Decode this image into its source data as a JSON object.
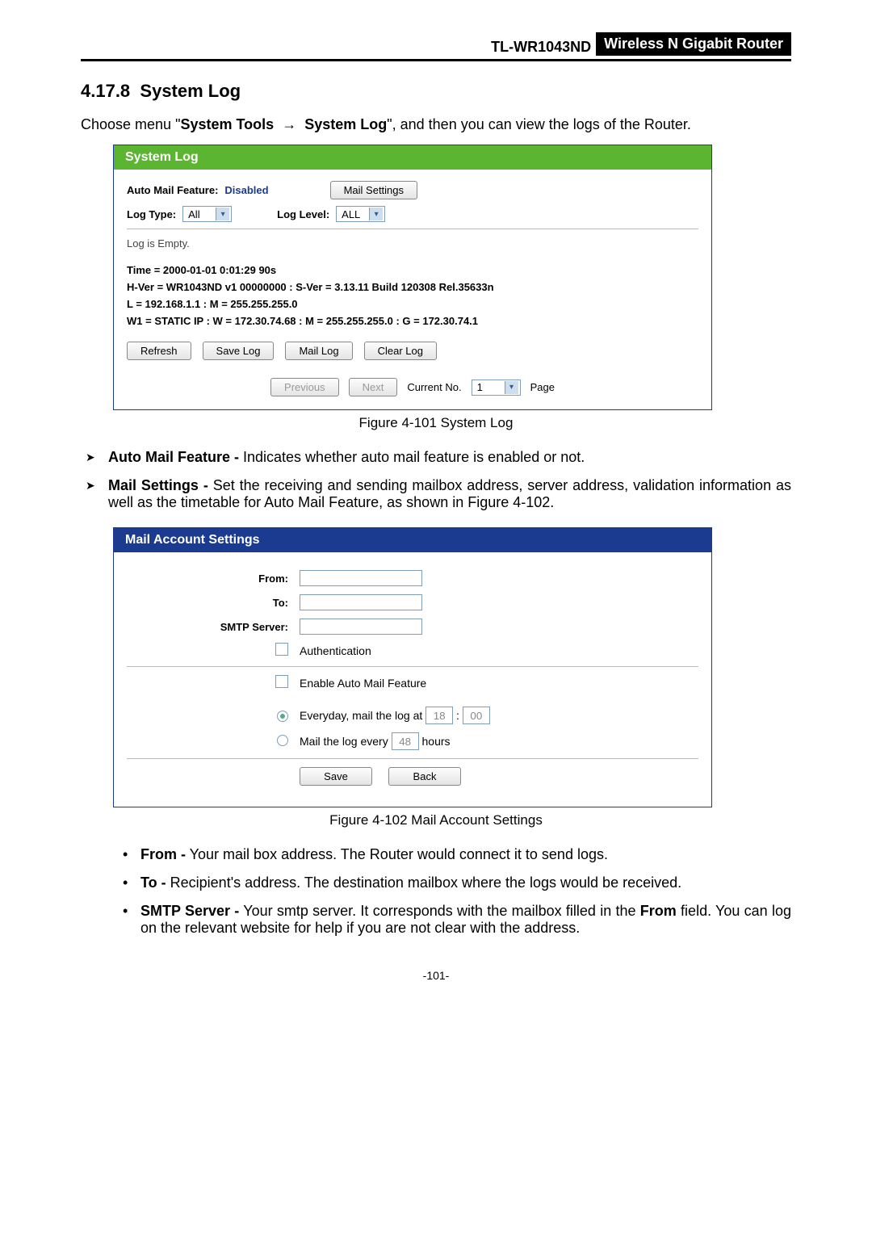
{
  "header": {
    "model": "TL-WR1043ND",
    "tagline": "Wireless N Gigabit Router"
  },
  "section": {
    "number": "4.17.8",
    "title": "System Log"
  },
  "intro": {
    "prefix": "Choose menu \"",
    "menu1": "System Tools",
    "menu2": "System Log",
    "suffix": "\", and then you can view the logs of the Router."
  },
  "fig1": {
    "title": "System Log",
    "auto_mail_label": "Auto Mail Feature:",
    "auto_mail_value": "Disabled",
    "mail_settings_btn": "Mail Settings",
    "log_type_label": "Log Type:",
    "log_type_value": "All",
    "log_level_label": "Log Level:",
    "log_level_value": "ALL",
    "log_empty": "Log is Empty.",
    "info_time": "Time = 2000-01-01 0:01:29 90s",
    "info_ver": "H-Ver = WR1043ND v1 00000000 : S-Ver = 3.13.11 Build 120308 Rel.35633n",
    "info_l": "L = 192.168.1.1 : M = 255.255.255.0",
    "info_w1": "W1 = STATIC IP : W = 172.30.74.68 : M = 255.255.255.0 : G = 172.30.74.1",
    "btn_refresh": "Refresh",
    "btn_save": "Save Log",
    "btn_mail": "Mail Log",
    "btn_clear": "Clear Log",
    "btn_prev": "Previous",
    "btn_next": "Next",
    "current_no_label": "Current No.",
    "current_no_value": "1",
    "page_label": "Page",
    "caption": "Figure 4-101    System Log"
  },
  "bullets_main": [
    {
      "term": "Auto Mail Feature -",
      "text": " Indicates whether auto mail feature is enabled or not."
    },
    {
      "term": "Mail Settings -",
      "text": " Set the receiving and sending mailbox address, server address, validation information as well as the timetable for Auto Mail Feature, as shown in Figure 4-102."
    }
  ],
  "fig2": {
    "title": "Mail Account Settings",
    "from_label": "From:",
    "to_label": "To:",
    "smtp_label": "SMTP Server:",
    "auth_label": "Authentication",
    "enable_label": "Enable Auto Mail Feature",
    "sched_daily_prefix": "Everyday, mail the log at",
    "sched_daily_hh": "18",
    "sched_daily_mm": "00",
    "sched_every_prefix": "Mail the log every",
    "sched_every_val": "48",
    "sched_every_unit": "hours",
    "btn_save": "Save",
    "btn_back": "Back",
    "caption": "Figure 4-102    Mail Account Settings"
  },
  "bullets_sub": [
    {
      "term": "From -",
      "text": " Your mail box address. The Router would connect it to send logs."
    },
    {
      "term": "To -",
      "text": " Recipient's address. The destination mailbox where the logs would be received."
    },
    {
      "term": "SMTP Server -",
      "text": " Your smtp server. It corresponds with the mailbox filled in the ",
      "term2": "From",
      "text2": " field. You can log on the relevant website for help if you are not clear with the address."
    }
  ],
  "page_number": "-101-"
}
